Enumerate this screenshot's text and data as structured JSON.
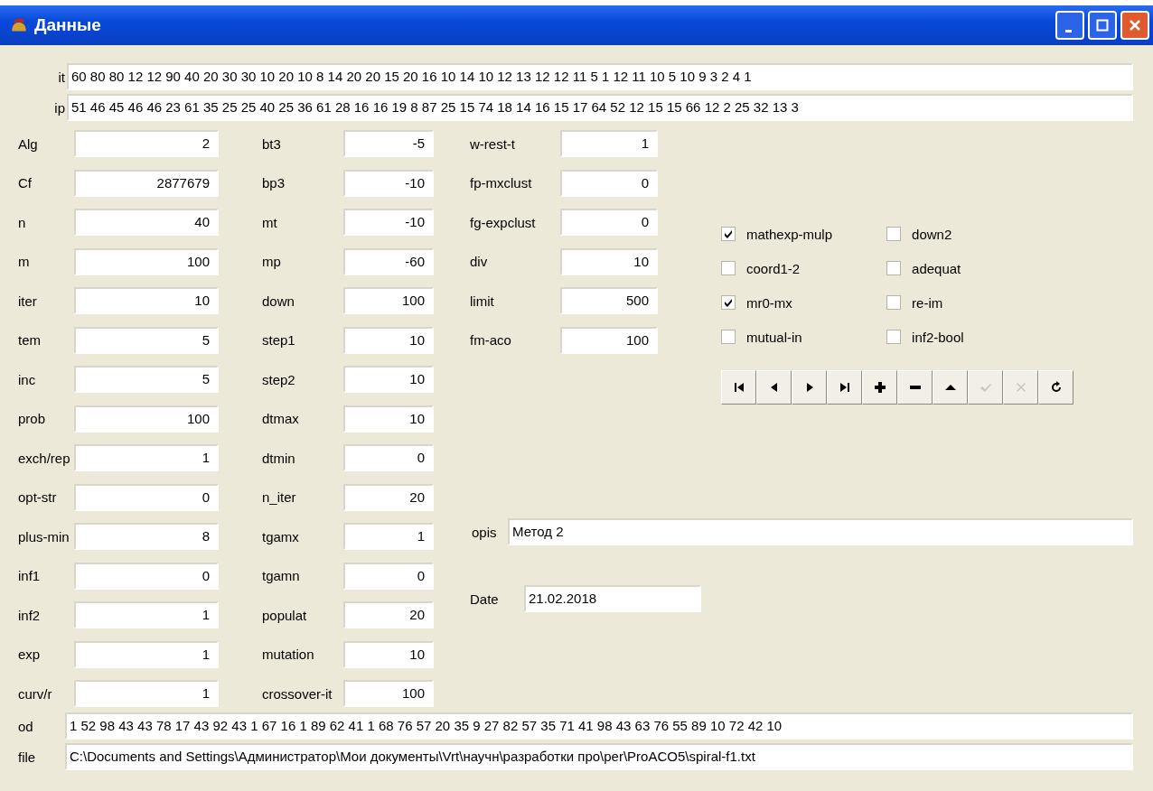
{
  "window": {
    "title": "Данные"
  },
  "it": {
    "label": "it",
    "value": "60 80 80 12 12 90 40 20 30 30 10 20 10 8 14 20 20 15 20 16 10 14 10 12 13 12 12 11 5 1 12 11 10 5 10 9 3 2 4 1"
  },
  "ip": {
    "label": "ip",
    "value": "51 46 45 46 46 23 61 35 25 25 40 25 36 61 28 16 16 19 8 87 25 15 74 18 14 16 15 17 64 52 12 15 15 66 12 2 25 32 13 3"
  },
  "column_1": [
    {
      "label": "Alg",
      "value": "2"
    },
    {
      "label": "Cf",
      "value": "2877679"
    },
    {
      "label": "n",
      "value": "40"
    },
    {
      "label": "m",
      "value": "100"
    },
    {
      "label": "iter",
      "value": "10"
    },
    {
      "label": "tem",
      "value": "5"
    },
    {
      "label": "inc",
      "value": "5"
    },
    {
      "label": "prob",
      "value": "100"
    },
    {
      "label": "exch/rep",
      "value": "1"
    },
    {
      "label": "opt-str",
      "value": "0"
    },
    {
      "label": "plus-min",
      "value": "8"
    },
    {
      "label": "inf1",
      "value": "0"
    },
    {
      "label": "inf2",
      "value": "1"
    },
    {
      "label": "exp",
      "value": "1"
    },
    {
      "label": "curv/r",
      "value": "1"
    }
  ],
  "column_2": [
    {
      "label": "bt3",
      "value": "-5"
    },
    {
      "label": "bp3",
      "value": "-10"
    },
    {
      "label": "mt",
      "value": "-10"
    },
    {
      "label": "mp",
      "value": "-60"
    },
    {
      "label": "down",
      "value": "100"
    },
    {
      "label": "step1",
      "value": "10"
    },
    {
      "label": "step2",
      "value": "10"
    },
    {
      "label": "dtmax",
      "value": "10"
    },
    {
      "label": "dtmin",
      "value": "0"
    },
    {
      "label": "n_iter",
      "value": "20"
    },
    {
      "label": "tgamx",
      "value": "1"
    },
    {
      "label": "tgamn",
      "value": "0"
    },
    {
      "label": "populat",
      "value": "20"
    },
    {
      "label": "mutation",
      "value": "10"
    },
    {
      "label": "crossover-it",
      "value": "100"
    }
  ],
  "column_3": [
    {
      "label": "w-rest-t",
      "value": "1"
    },
    {
      "label": "fp-mxclust",
      "value": "0"
    },
    {
      "label": "fg-expclust",
      "value": "0"
    },
    {
      "label": "div",
      "value": "10"
    },
    {
      "label": "limit",
      "value": "500"
    },
    {
      "label": "fm-aco",
      "value": "100"
    }
  ],
  "checkboxes_1": [
    {
      "label": "mathexp-mulp",
      "checked": true
    },
    {
      "label": "coord1-2",
      "checked": false
    },
    {
      "label": "mr0-mx",
      "checked": true
    },
    {
      "label": "mutual-in",
      "checked": false
    }
  ],
  "checkboxes_2": [
    {
      "label": "down2",
      "checked": false
    },
    {
      "label": "adequat",
      "checked": false
    },
    {
      "label": "re-im",
      "checked": false
    },
    {
      "label": "inf2-bool",
      "checked": false
    }
  ],
  "navigator": [
    {
      "kind": "first",
      "disabled": false
    },
    {
      "kind": "prior",
      "disabled": false
    },
    {
      "kind": "next",
      "disabled": false
    },
    {
      "kind": "last",
      "disabled": false
    },
    {
      "kind": "insert",
      "disabled": false
    },
    {
      "kind": "delete",
      "disabled": false
    },
    {
      "kind": "edit",
      "disabled": false
    },
    {
      "kind": "post",
      "disabled": true
    },
    {
      "kind": "cancel",
      "disabled": true
    },
    {
      "kind": "refresh",
      "disabled": false
    }
  ],
  "opis": {
    "label": "opis",
    "value": "Метод 2"
  },
  "date": {
    "label": "Date",
    "value": "21.02.2018"
  },
  "od": {
    "label": "od",
    "value": "1 52 98 43 43 78 17 43 92 43 1 67 16 1 89 62 41 1 68 76 57 20 35 9 27 82 57 35 71 41 98 43 63 76 55 89 10 72 42 10"
  },
  "file": {
    "label": "file",
    "value": "C:\\Documents and Settings\\Администратор\\Мои документы\\Vrt\\научн\\разработки про\\per\\ProACO5\\spiral-f1.txt"
  }
}
